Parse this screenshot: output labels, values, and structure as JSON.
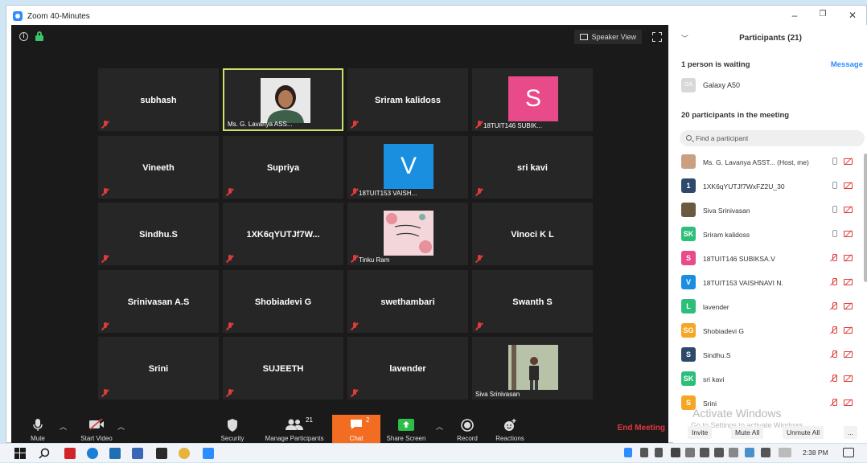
{
  "window": {
    "title": "Zoom 40-Minutes",
    "minimize": "–",
    "restore": "❐",
    "close": "✕"
  },
  "stage": {
    "speaker_view_label": "Speaker View"
  },
  "tiles": [
    {
      "name": "subhash",
      "label": ""
    },
    {
      "name": "",
      "label": "Ms. G. Lavanya ASS..."
    },
    {
      "name": "Sriram kalidoss",
      "label": ""
    },
    {
      "name": "",
      "label": "18TUIT146 SUBIK...",
      "avatar_letter": "S",
      "avatar_color": "#e84a8a"
    },
    {
      "name": "Vineeth",
      "label": ""
    },
    {
      "name": "Supriya",
      "label": ""
    },
    {
      "name": "",
      "label": "18TUIT153 VAISH...",
      "avatar_letter": "V",
      "avatar_color": "#1a8fe0"
    },
    {
      "name": "sri kavi",
      "label": ""
    },
    {
      "name": "Sindhu.S",
      "label": ""
    },
    {
      "name": "1XK6qYUTJf7W...",
      "label": ""
    },
    {
      "name": "",
      "label": "Tinku Ram"
    },
    {
      "name": "Vinoci K L",
      "label": ""
    },
    {
      "name": "Srinivasan A.S",
      "label": ""
    },
    {
      "name": "Shobiadevi G",
      "label": ""
    },
    {
      "name": "swethambari",
      "label": ""
    },
    {
      "name": "Swanth S",
      "label": ""
    },
    {
      "name": "Srini",
      "label": ""
    },
    {
      "name": "SUJEETH",
      "label": ""
    },
    {
      "name": "lavender",
      "label": ""
    },
    {
      "name": "",
      "label": "Siva Srinivasan"
    }
  ],
  "toolbar": {
    "mute": "Mute",
    "start_video": "Start Video",
    "security": "Security",
    "manage_participants": "Manage Participants",
    "participants_count": "21",
    "chat": "Chat",
    "chat_badge": "2",
    "share_screen": "Share Screen",
    "record": "Record",
    "reactions": "Reactions",
    "end_meeting": "End Meeting"
  },
  "panel": {
    "title": "Participants (21)",
    "waiting": "1 person is waiting",
    "message": "Message",
    "waiting_person": {
      "initials": "GA",
      "name": "Galaxy A50"
    },
    "in_meeting": "20 participants in the meeting",
    "search_placeholder": "Find a participant",
    "participants": [
      {
        "initials": "",
        "name": "Ms. G. Lavanya ASST...  (Host, me)",
        "color": "#caa080",
        "mic_muted": false
      },
      {
        "initials": "1",
        "name": "1XK6qYUTJf7WxFZ2U_30",
        "color": "#2e4a6b",
        "mic_muted": false
      },
      {
        "initials": "",
        "name": "Siva Srinivasan",
        "color": "#6b5a40",
        "mic_muted": false
      },
      {
        "initials": "SK",
        "name": "Sriram kalidoss",
        "color": "#2dbf7a",
        "mic_muted": false
      },
      {
        "initials": "S",
        "name": "18TUIT146 SUBIKSA.V",
        "color": "#e84a8a",
        "mic_muted": true
      },
      {
        "initials": "V",
        "name": "18TUIT153 VAISHNAVI N.",
        "color": "#1a8fe0",
        "mic_muted": true
      },
      {
        "initials": "L",
        "name": "lavender",
        "color": "#2dbf7a",
        "mic_muted": true
      },
      {
        "initials": "SG",
        "name": "Shobiadevi G",
        "color": "#f5a623",
        "mic_muted": true
      },
      {
        "initials": "S",
        "name": "Sindhu.S",
        "color": "#2e4a6b",
        "mic_muted": true
      },
      {
        "initials": "SK",
        "name": "sri kavi",
        "color": "#2dbf7a",
        "mic_muted": true
      },
      {
        "initials": "S",
        "name": "Srini",
        "color": "#f5a623",
        "mic_muted": true
      }
    ],
    "watermark_title": "Activate Windows",
    "watermark_sub": "Go to Settings to activate Windows.",
    "invite": "Invite",
    "mute_all": "Mute All",
    "unmute_all": "Unmute All",
    "more": "..."
  },
  "taskbar": {
    "time": "2:38 PM"
  }
}
